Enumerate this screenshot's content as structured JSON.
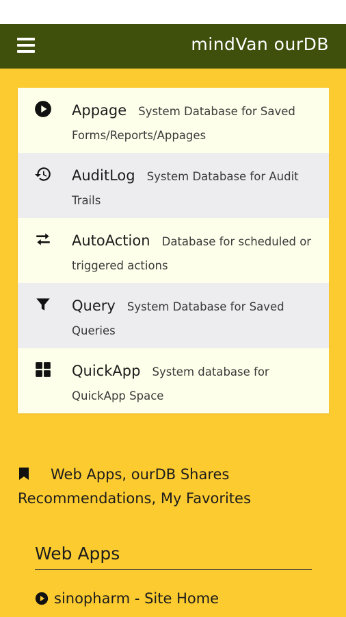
{
  "header": {
    "title": "mindVan ourDB",
    "menu_icon": "hamburger-menu-icon",
    "bar_color": "#3f500d"
  },
  "colors": {
    "background": "#fccb30",
    "row_light": "#fdffea",
    "row_gray": "#ededef"
  },
  "databases": [
    {
      "name": "Appage",
      "description": "System Database for Saved Forms/Reports/Appages",
      "icon": "play-circle-icon"
    },
    {
      "name": "AuditLog",
      "description": "System Database for Audit Trails",
      "icon": "history-icon"
    },
    {
      "name": "AutoAction",
      "description": "Database for scheduled or triggered actions",
      "icon": "swap-arrows-icon"
    },
    {
      "name": "Query",
      "description": "System Database for Saved Queries",
      "icon": "filter-icon"
    },
    {
      "name": "QuickApp",
      "description": "System database for QuickApp Space",
      "icon": "grid-icon"
    }
  ],
  "shares": {
    "icon": "bookmark-icon",
    "text": "Web Apps, ourDB Shares Recommendations, My Favorites"
  },
  "web_apps": {
    "title": "Web Apps",
    "items": [
      {
        "label": "sinopharm - Site Home",
        "icon": "play-circle-icon"
      }
    ]
  }
}
